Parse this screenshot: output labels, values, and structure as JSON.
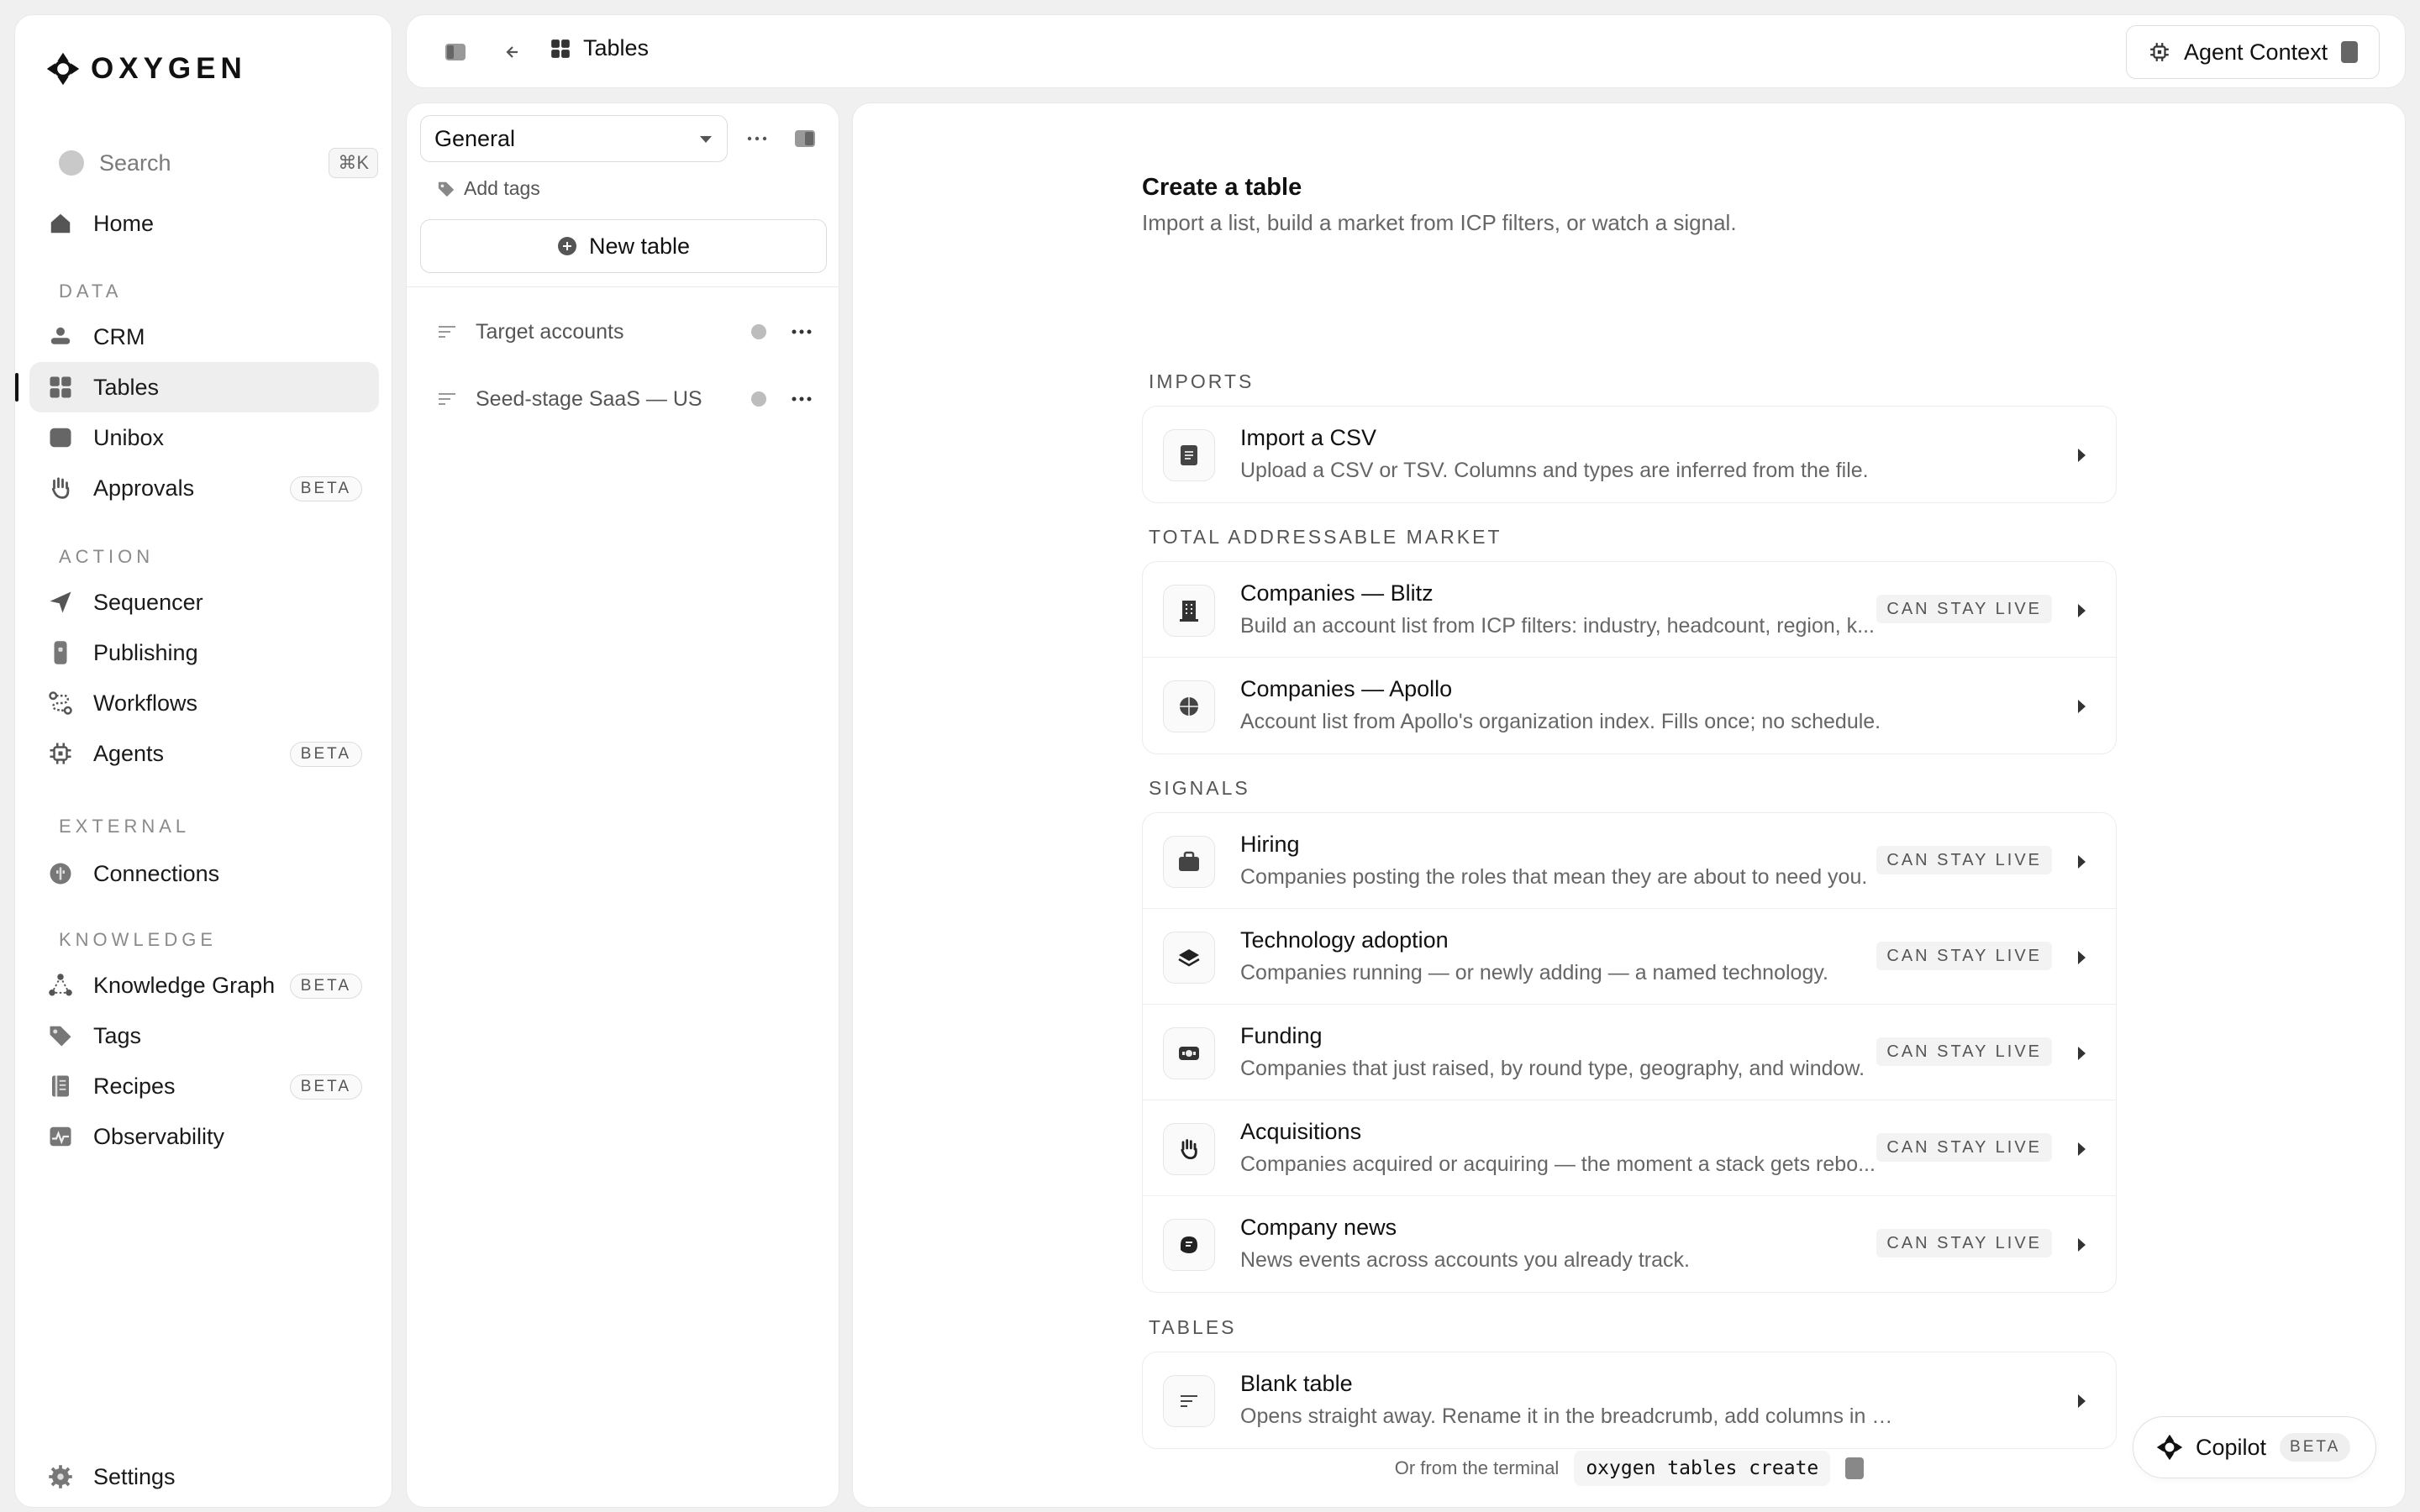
{
  "brand": {
    "name": "OXYGEN"
  },
  "search": {
    "label": "Search",
    "shortcut": "⌘K"
  },
  "sidebar": {
    "home": "Home",
    "sections": {
      "data": "DATA",
      "action": "ACTION",
      "external": "EXTERNAL",
      "knowledge": "KNOWLEDGE"
    },
    "items": {
      "crm": "CRM",
      "tables": "Tables",
      "unibox": "Unibox",
      "approvals": "Approvals",
      "sequencer": "Sequencer",
      "publishing": "Publishing",
      "workflows": "Workflows",
      "agents": "Agents",
      "connections": "Connections",
      "knowledge_graph": "Knowledge Graph",
      "tags": "Tags",
      "recipes": "Recipes",
      "observability": "Observability"
    },
    "beta": "BETA",
    "settings": "Settings"
  },
  "topbar": {
    "breadcrumb": "Tables",
    "agent_context": "Agent Context"
  },
  "tablelist": {
    "workspace": "General",
    "add_tags": "Add tags",
    "new_table": "New table",
    "items": [
      "Target accounts",
      "Seed-stage SaaS — US"
    ]
  },
  "main": {
    "title": "Create a table",
    "subtitle": "Import a list, build a market from ICP filters, or watch a signal.",
    "sections": {
      "imports": "IMPORTS",
      "tam": "TOTAL ADDRESSABLE MARKET",
      "signals": "SIGNALS",
      "tables": "TABLES"
    },
    "can_stay_live": "CAN STAY LIVE",
    "imports": [
      {
        "title": "Import a CSV",
        "desc": "Upload a CSV or TSV. Columns and types are inferred from the file."
      }
    ],
    "tam": [
      {
        "title": "Companies — Blitz",
        "desc": "Build an account list from ICP filters: industry, headcount, region, k..."
      },
      {
        "title": "Companies — Apollo",
        "desc": "Account list from Apollo's organization index. Fills once; no schedule."
      }
    ],
    "signals": [
      {
        "title": "Hiring",
        "desc": "Companies posting the roles that mean they are about to need you."
      },
      {
        "title": "Technology adoption",
        "desc": "Companies running — or newly adding — a named technology."
      },
      {
        "title": "Funding",
        "desc": "Companies that just raised, by round type, geography, and window."
      },
      {
        "title": "Acquisitions",
        "desc": "Companies acquired or acquiring — the moment a stack gets rebo..."
      },
      {
        "title": "Company news",
        "desc": "News events across accounts you already track."
      }
    ],
    "tables": [
      {
        "title": "Blank table",
        "desc": "Opens straight away. Rename it in the breadcrumb, add columns in the grid."
      }
    ],
    "terminal": {
      "label": "Or from the terminal",
      "command": "oxygen tables create"
    }
  },
  "copilot": {
    "label": "Copilot",
    "badge": "BETA"
  }
}
